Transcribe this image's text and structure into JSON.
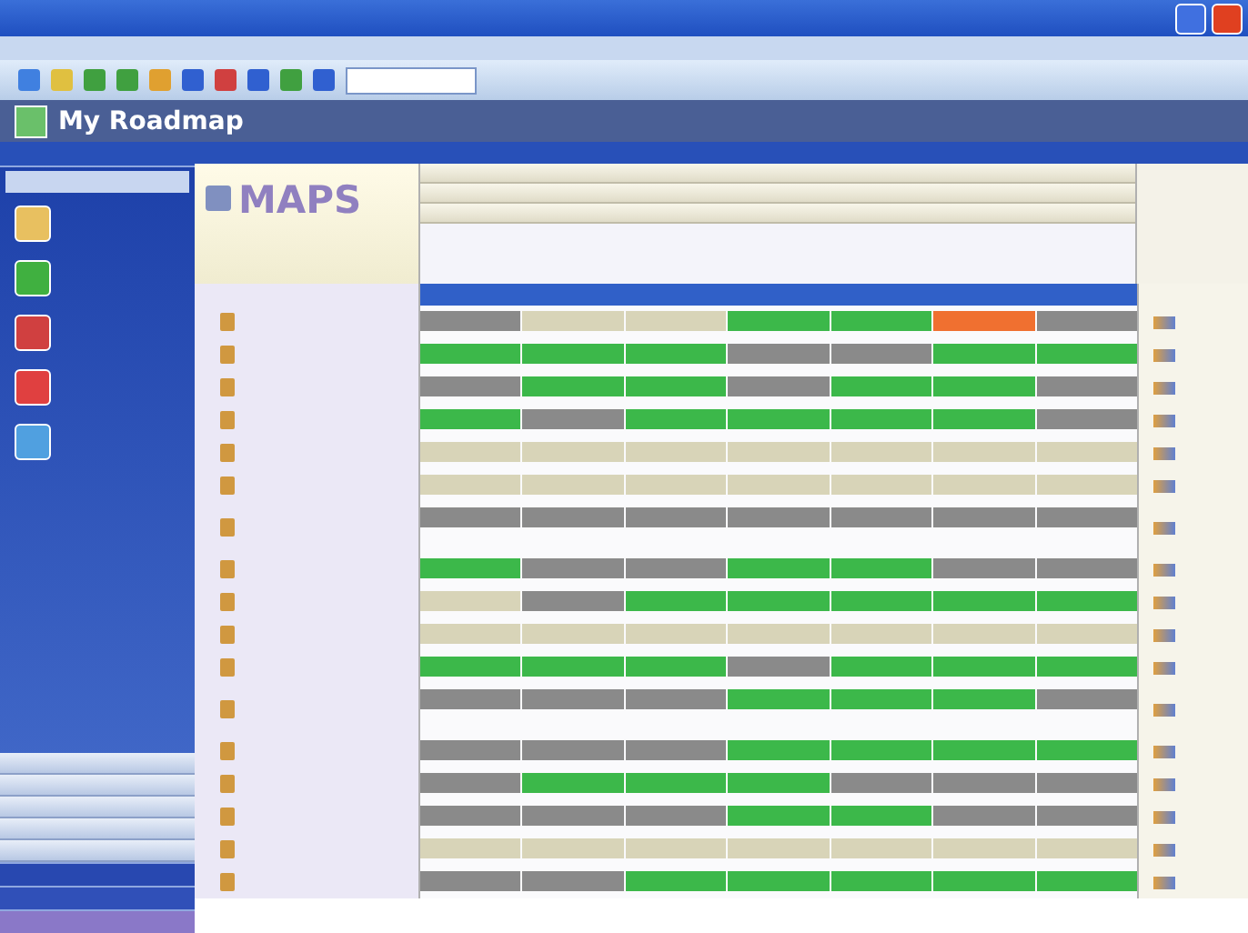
{
  "header": {
    "title": "My Roadmap"
  },
  "logo": {
    "text": "MAPS"
  },
  "sidebar": {
    "items": [
      {
        "color": "#e8c060"
      },
      {
        "color": "#40b040"
      },
      {
        "color": "#d04040"
      },
      {
        "color": "#e04040"
      },
      {
        "color": "#50a0e0"
      }
    ]
  },
  "rows": [
    {
      "tall": false,
      "cells": [
        {
          "color": "#8a8a8a"
        },
        {
          "color": "#d8d4b8"
        },
        {
          "color": "#d8d4b8"
        },
        {
          "color": "#3cb84a"
        },
        {
          "color": "#3cb84a"
        },
        {
          "color": "#f07030"
        },
        {
          "color": "#8a8a8a"
        }
      ]
    },
    {
      "tall": false,
      "cells": [
        {
          "color": "#3cb84a"
        },
        {
          "color": "#3cb84a"
        },
        {
          "color": "#3cb84a"
        },
        {
          "color": "#8a8a8a"
        },
        {
          "color": "#8a8a8a"
        },
        {
          "color": "#3cb84a"
        },
        {
          "color": "#3cb84a"
        }
      ]
    },
    {
      "tall": false,
      "cells": [
        {
          "color": "#8a8a8a"
        },
        {
          "color": "#3cb84a"
        },
        {
          "color": "#3cb84a"
        },
        {
          "color": "#8a8a8a"
        },
        {
          "color": "#3cb84a"
        },
        {
          "color": "#3cb84a"
        },
        {
          "color": "#8a8a8a"
        }
      ]
    },
    {
      "tall": false,
      "cells": [
        {
          "color": "#3cb84a"
        },
        {
          "color": "#8a8a8a"
        },
        {
          "color": "#3cb84a"
        },
        {
          "color": "#3cb84a"
        },
        {
          "color": "#3cb84a"
        },
        {
          "color": "#3cb84a"
        },
        {
          "color": "#8a8a8a"
        }
      ]
    },
    {
      "tall": false,
      "cells": [
        {
          "color": "#d8d4b8"
        },
        {
          "color": "#d8d4b8"
        },
        {
          "color": "#d8d4b8"
        },
        {
          "color": "#d8d4b8"
        },
        {
          "color": "#d8d4b8"
        },
        {
          "color": "#d8d4b8"
        },
        {
          "color": "#d8d4b8"
        }
      ]
    },
    {
      "tall": false,
      "cells": [
        {
          "color": "#d8d4b8"
        },
        {
          "color": "#d8d4b8"
        },
        {
          "color": "#d8d4b8"
        },
        {
          "color": "#d8d4b8"
        },
        {
          "color": "#d8d4b8"
        },
        {
          "color": "#d8d4b8"
        },
        {
          "color": "#d8d4b8"
        }
      ]
    },
    {
      "tall": true,
      "cells": [
        {
          "color": "#8a8a8a"
        },
        {
          "color": "#8a8a8a"
        },
        {
          "color": "#8a8a8a"
        },
        {
          "color": "#8a8a8a"
        },
        {
          "color": "#8a8a8a"
        },
        {
          "color": "#8a8a8a"
        },
        {
          "color": "#8a8a8a"
        }
      ]
    },
    {
      "tall": false,
      "cells": [
        {
          "color": "#3cb84a"
        },
        {
          "color": "#8a8a8a"
        },
        {
          "color": "#8a8a8a"
        },
        {
          "color": "#3cb84a"
        },
        {
          "color": "#3cb84a"
        },
        {
          "color": "#8a8a8a"
        },
        {
          "color": "#8a8a8a"
        }
      ]
    },
    {
      "tall": false,
      "cells": [
        {
          "color": "#d8d4b8"
        },
        {
          "color": "#8a8a8a"
        },
        {
          "color": "#3cb84a"
        },
        {
          "color": "#3cb84a"
        },
        {
          "color": "#3cb84a"
        },
        {
          "color": "#3cb84a"
        },
        {
          "color": "#3cb84a"
        }
      ]
    },
    {
      "tall": false,
      "cells": [
        {
          "color": "#d8d4b8"
        },
        {
          "color": "#d8d4b8"
        },
        {
          "color": "#d8d4b8"
        },
        {
          "color": "#d8d4b8"
        },
        {
          "color": "#d8d4b8"
        },
        {
          "color": "#d8d4b8"
        },
        {
          "color": "#d8d4b8"
        }
      ]
    },
    {
      "tall": false,
      "cells": [
        {
          "color": "#3cb84a"
        },
        {
          "color": "#3cb84a"
        },
        {
          "color": "#3cb84a"
        },
        {
          "color": "#8a8a8a"
        },
        {
          "color": "#3cb84a"
        },
        {
          "color": "#3cb84a"
        },
        {
          "color": "#3cb84a"
        }
      ]
    },
    {
      "tall": true,
      "cells": [
        {
          "color": "#8a8a8a"
        },
        {
          "color": "#8a8a8a"
        },
        {
          "color": "#8a8a8a"
        },
        {
          "color": "#3cb84a"
        },
        {
          "color": "#3cb84a"
        },
        {
          "color": "#3cb84a"
        },
        {
          "color": "#8a8a8a"
        }
      ]
    },
    {
      "tall": false,
      "cells": [
        {
          "color": "#8a8a8a"
        },
        {
          "color": "#8a8a8a"
        },
        {
          "color": "#8a8a8a"
        },
        {
          "color": "#3cb84a"
        },
        {
          "color": "#3cb84a"
        },
        {
          "color": "#3cb84a"
        },
        {
          "color": "#3cb84a"
        }
      ]
    },
    {
      "tall": false,
      "cells": [
        {
          "color": "#8a8a8a"
        },
        {
          "color": "#3cb84a"
        },
        {
          "color": "#3cb84a"
        },
        {
          "color": "#3cb84a"
        },
        {
          "color": "#8a8a8a"
        },
        {
          "color": "#8a8a8a"
        },
        {
          "color": "#8a8a8a"
        }
      ]
    },
    {
      "tall": false,
      "cells": [
        {
          "color": "#8a8a8a"
        },
        {
          "color": "#8a8a8a"
        },
        {
          "color": "#8a8a8a"
        },
        {
          "color": "#3cb84a"
        },
        {
          "color": "#3cb84a"
        },
        {
          "color": "#8a8a8a"
        },
        {
          "color": "#8a8a8a"
        }
      ]
    },
    {
      "tall": false,
      "cells": [
        {
          "color": "#d8d4b8"
        },
        {
          "color": "#d8d4b8"
        },
        {
          "color": "#d8d4b8"
        },
        {
          "color": "#d8d4b8"
        },
        {
          "color": "#d8d4b8"
        },
        {
          "color": "#d8d4b8"
        },
        {
          "color": "#d8d4b8"
        }
      ]
    },
    {
      "tall": false,
      "cells": [
        {
          "color": "#8a8a8a"
        },
        {
          "color": "#8a8a8a"
        },
        {
          "color": "#3cb84a"
        },
        {
          "color": "#3cb84a"
        },
        {
          "color": "#3cb84a"
        },
        {
          "color": "#3cb84a"
        },
        {
          "color": "#3cb84a"
        }
      ]
    }
  ]
}
